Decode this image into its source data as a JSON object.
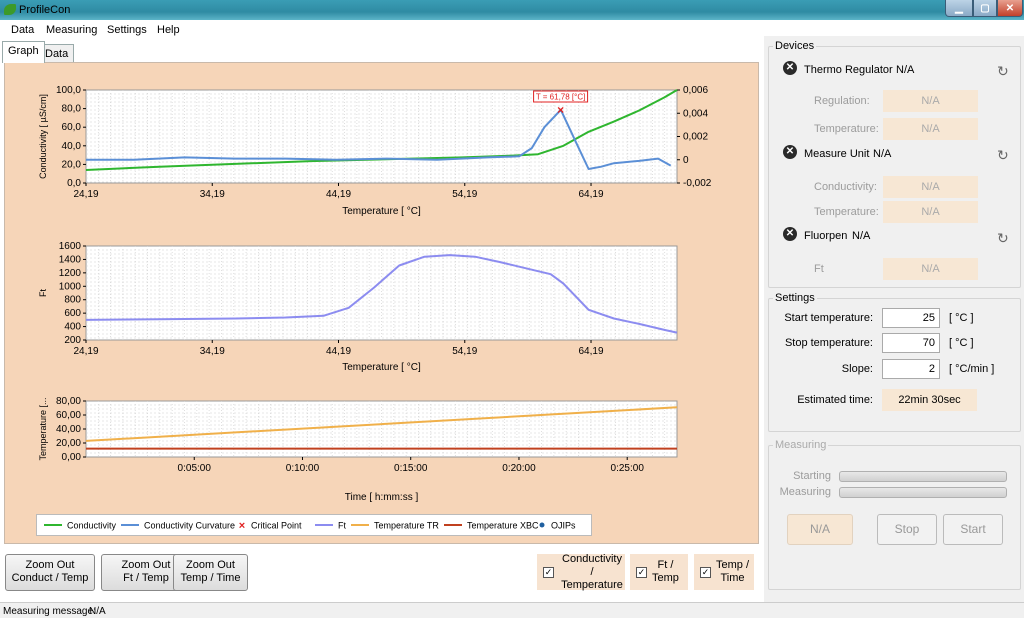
{
  "window": {
    "title": "ProfileCon"
  },
  "menu": [
    "Data",
    "Measuring",
    "Settings",
    "Help"
  ],
  "tabs": [
    {
      "label": "Graph",
      "active": true
    },
    {
      "label": "Data",
      "active": false
    }
  ],
  "colors": {
    "conductivity": "#2fb62f",
    "curvature": "#5b8fd6",
    "critical": "#e02020",
    "ft": "#8c8cf0",
    "temp_tr": "#f0b04a",
    "temp_xbc": "#c0401f",
    "ojip": "#2060a0",
    "panel_bg": "#f6d5b8"
  },
  "chart_data": [
    {
      "type": "line",
      "ylabel": "Conductivity [ µS/cm]",
      "xlabel": "Temperature [ °C]",
      "x_ticks": [
        "24,19",
        "34,19",
        "44,19",
        "54,19",
        "64,19"
      ],
      "x_range": [
        24.19,
        71.0
      ],
      "y_ticks": [
        "100,0",
        "80,0",
        "60,0",
        "40,0",
        "20,0",
        "0,0"
      ],
      "y_range": [
        0,
        100
      ],
      "y2_ticks": [
        "0,006",
        "0,004",
        "0,002",
        "0",
        "-0,002"
      ],
      "y2_range": [
        -0.002,
        0.006
      ],
      "annotation": "T = 61,78 [°C]",
      "critical_point": {
        "x": 61.78,
        "y2": 0.0043
      },
      "series": [
        {
          "name": "Conductivity",
          "axis": "y",
          "x": [
            24.19,
            30,
            36,
            42,
            48,
            54,
            58,
            60,
            62,
            64,
            66,
            68,
            70,
            71
          ],
          "values": [
            14.0,
            17.5,
            20.5,
            23.5,
            25.5,
            27.5,
            29.5,
            31.0,
            40.0,
            55.0,
            66.0,
            78.0,
            92.0,
            100.0
          ]
        },
        {
          "name": "Conductivity Curvature",
          "axis": "y2",
          "x": [
            24.19,
            28,
            32,
            36,
            40,
            44,
            48,
            52,
            56,
            58.5,
            59.5,
            60.5,
            61.8,
            63,
            64,
            65,
            66,
            68,
            69.5,
            70.5
          ],
          "values": [
            0.0,
            0.0,
            0.0002,
            0.0001,
            0.0001,
            0.0,
            0.0001,
            0.0,
            0.0002,
            0.0003,
            0.001,
            0.0028,
            0.0043,
            0.0015,
            -0.0008,
            -0.0006,
            -0.0003,
            -0.0001,
            0.0001,
            -0.0005
          ]
        }
      ]
    },
    {
      "type": "line",
      "ylabel": "Ft",
      "xlabel": "Temperature [ °C]",
      "x_ticks": [
        "24,19",
        "34,19",
        "44,19",
        "54,19",
        "64,19"
      ],
      "x_range": [
        24.19,
        71.0
      ],
      "y_ticks": [
        "1600",
        "1400",
        "1200",
        "1000",
        "800",
        "600",
        "400",
        "200"
      ],
      "y_range": [
        200,
        1600
      ],
      "series": [
        {
          "name": "Ft",
          "x": [
            24.19,
            30,
            36,
            40,
            43,
            45,
            47,
            49,
            51,
            53,
            55,
            57,
            59,
            61,
            62,
            64,
            66,
            68,
            70,
            71
          ],
          "values": [
            500,
            510,
            520,
            535,
            560,
            680,
            980,
            1310,
            1440,
            1465,
            1440,
            1360,
            1270,
            1180,
            1040,
            650,
            520,
            440,
            350,
            310
          ]
        }
      ]
    },
    {
      "type": "line",
      "ylabel": "Temperature [...",
      "xlabel": "Time  [ h:mm:ss ]",
      "x_ticks": [
        "0:05:00",
        "0:10:00",
        "0:15:00",
        "0:20:00",
        "0:25:00"
      ],
      "x_range": [
        0,
        27.3
      ],
      "y_ticks": [
        "80,00",
        "60,00",
        "40,00",
        "20,00",
        "0,00"
      ],
      "y_range": [
        0,
        80
      ],
      "series": [
        {
          "name": "Temperature TR",
          "x": [
            0,
            27.3
          ],
          "values": [
            23,
            71
          ]
        },
        {
          "name": "Temperature XBC",
          "x": [
            0,
            27.3
          ],
          "values": [
            12,
            12
          ]
        }
      ]
    }
  ],
  "legend": [
    {
      "label": "Conductivity",
      "kind": "line",
      "color": "#2fb62f"
    },
    {
      "label": "Conductivity Curvature",
      "kind": "line",
      "color": "#5b8fd6"
    },
    {
      "label": "Critical Point",
      "kind": "x",
      "color": "#e02020"
    },
    {
      "label": "Ft",
      "kind": "line",
      "color": "#8c8cf0"
    },
    {
      "label": "Temperature TR",
      "kind": "line",
      "color": "#f0b04a"
    },
    {
      "label": "Temperature XBC",
      "kind": "line",
      "color": "#c0401f"
    },
    {
      "label": "OJIPs",
      "kind": "dot",
      "color": "#2060a0"
    }
  ],
  "zoom_buttons": [
    {
      "line1": "Zoom Out",
      "line2": "Conduct / Temp"
    },
    {
      "line1": "Zoom Out",
      "line2": "Ft / Temp"
    },
    {
      "line1": "Zoom Out",
      "line2": "Temp / Time"
    }
  ],
  "checkboxes": [
    {
      "line1": "Conductivity /",
      "line2": "Temperature",
      "checked": true
    },
    {
      "line1": "Ft /",
      "line2": "Temp",
      "checked": true
    },
    {
      "line1": "Temp /",
      "line2": "Time",
      "checked": true
    }
  ],
  "devices": {
    "title": "Devices",
    "items": [
      {
        "name": "Thermo Regulator",
        "status": "N/A",
        "fields": [
          {
            "label": "Regulation:",
            "value": "N/A"
          },
          {
            "label": "Temperature:",
            "value": "N/A"
          }
        ]
      },
      {
        "name": "Measure Unit",
        "status": "N/A",
        "fields": [
          {
            "label": "Conductivity:",
            "value": "N/A"
          },
          {
            "label": "Temperature:",
            "value": "N/A"
          }
        ]
      },
      {
        "name": "Fluorpen",
        "status": "N/A",
        "fields": [
          {
            "label": "Ft",
            "value": "N/A"
          }
        ]
      }
    ]
  },
  "settings": {
    "title": "Settings",
    "start_label": "Start temperature:",
    "start_value": "25",
    "start_unit": "[ °C ]",
    "stop_label": "Stop temperature:",
    "stop_value": "70",
    "stop_unit": "[ °C ]",
    "slope_label": "Slope:",
    "slope_value": "2",
    "slope_unit": "[ °C/min ]",
    "est_label": "Estimated time:",
    "est_value": "22min 30sec"
  },
  "measuring": {
    "title": "Measuring",
    "starting_label": "Starting",
    "measuring_label": "Measuring",
    "status_value": "N/A",
    "stop_label": "Stop",
    "start_label": "Start"
  },
  "status": {
    "label": "Measuring message:",
    "value": "N/A"
  }
}
